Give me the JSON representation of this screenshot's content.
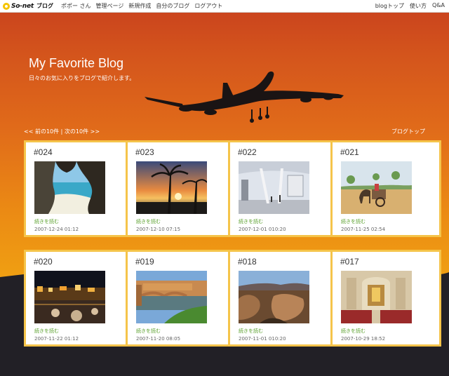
{
  "topbar": {
    "logo_text": "So-net",
    "logo_sub": "ブログ",
    "nav_left": [
      "ポポー さん",
      "管理ページ",
      "新規作成",
      "自分のブログ",
      "ログアウト"
    ],
    "nav_right": [
      "blogトップ",
      "使い方",
      "Q&A"
    ]
  },
  "header": {
    "title": "My Favorite Blog",
    "subtitle": "日々のお気に入りをブログで紹介します。"
  },
  "pager": {
    "prev": "<< 前の10件",
    "sep": " | ",
    "next": "次の10件 >>",
    "blog_top": "ブログトップ"
  },
  "posts": [
    {
      "num": "#024",
      "read_more": "続きを読む",
      "date": "2007-12-24 01:12",
      "photo": "coastal-rock-arch"
    },
    {
      "num": "#023",
      "read_more": "続きを読む",
      "date": "2007-12-10 07:15",
      "photo": "palm-sunset"
    },
    {
      "num": "#022",
      "read_more": "続きを読む",
      "date": "2007-12-01 010:20",
      "photo": "airport-terminal"
    },
    {
      "num": "#021",
      "read_more": "続きを読む",
      "date": "2007-11-25 02:54",
      "photo": "camel-cart"
    },
    {
      "num": "#020",
      "read_more": "続きを読む",
      "date": "2007-11-22 01:12",
      "photo": "night-harbor"
    },
    {
      "num": "#019",
      "read_more": "続きを読む",
      "date": "2007-11-20 08:05",
      "photo": "old-bridge"
    },
    {
      "num": "#018",
      "read_more": "続きを読む",
      "date": "2007-11-01 010:20",
      "photo": "canyon"
    },
    {
      "num": "#017",
      "read_more": "続きを読む",
      "date": "2007-10-29 18:52",
      "photo": "cathedral-interior"
    }
  ],
  "colors": {
    "sky_top": "#c8401e",
    "sky_bottom": "#f2a812",
    "card_border": "#f5c44a",
    "link_green": "#5aa02c",
    "ground": "#222026"
  }
}
